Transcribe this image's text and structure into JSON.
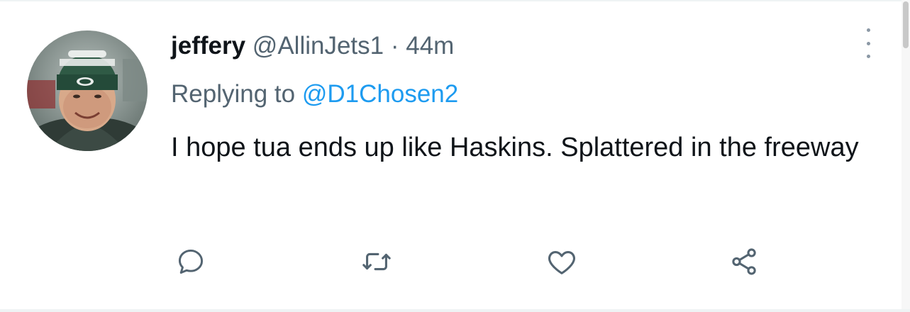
{
  "tweet": {
    "display_name": "jeffery",
    "handle": "@AllinJets1",
    "separator": "·",
    "time": "44m",
    "replying_prefix": "Replying to",
    "replying_to": "@D1Chosen2",
    "text": "I hope tua ends up like Haskins. Splattered in the freeway"
  },
  "actions": [
    {
      "name": "reply",
      "icon": "speech-bubble-icon"
    },
    {
      "name": "retweet",
      "icon": "retweet-arrows-icon"
    },
    {
      "name": "like",
      "icon": "heart-icon"
    },
    {
      "name": "share",
      "icon": "share-nodes-icon"
    }
  ],
  "colors": {
    "text_primary": "#0f1419",
    "text_secondary": "#536471",
    "link": "#1d9bf0",
    "icon": "#536471",
    "divider": "#eff3f4"
  }
}
